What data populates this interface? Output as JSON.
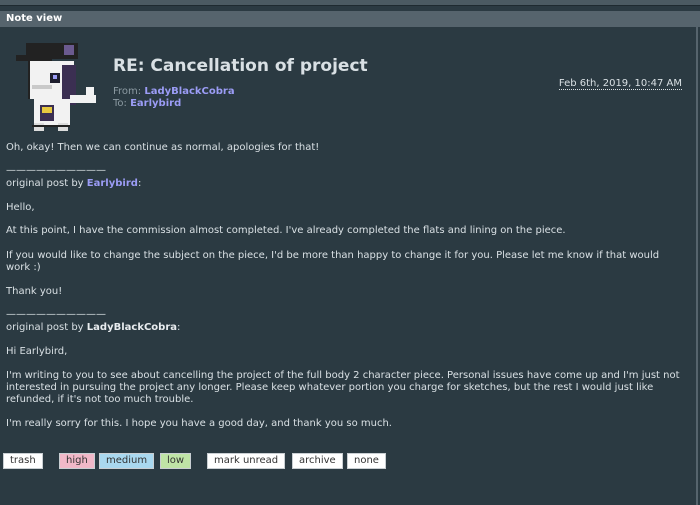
{
  "header": {
    "title": "Note view"
  },
  "note": {
    "subject": "RE: Cancellation of project",
    "from_label": "From:",
    "from_user": "LadyBlackCobra",
    "to_label": "To:",
    "to_user": "Earlybird",
    "date": "Feb 6th, 2019, 10:47 AM"
  },
  "body": {
    "reply": "Oh, okay! Then we can continue as normal, apologies for that!",
    "sep1": "——————————",
    "orig1_prefix": "original post by",
    "orig1_user": "Earlybird",
    "orig1_suffix": ":",
    "p1": "Hello,",
    "p2": "At this point, I have the commission almost completed. I've already completed the flats and lining on the piece.",
    "p3": "If you would like to change the subject on the piece, I'd be more than happy to change it for you. Please let me know if that would work :)",
    "p4": "Thank you!",
    "sep2": "——————————",
    "orig2_prefix": "original post by",
    "orig2_user": "LadyBlackCobra",
    "orig2_suffix": ":",
    "p5": "Hi Earlybird,",
    "p6": "I'm writing to you to see about cancelling the project of the full body 2 character piece. Personal issues have come up and I'm just not interested in pursuing the project any longer. Please keep whatever portion you charge for sketches, but the rest I would just like refunded, if it's not too much trouble.",
    "p7": "I'm really sorry for this. I hope you have a good day, and thank you so much."
  },
  "buttons": {
    "trash": "trash",
    "high": "high",
    "medium": "medium",
    "low": "low",
    "mark_unread": "mark unread",
    "archive": "archive",
    "none": "none"
  }
}
